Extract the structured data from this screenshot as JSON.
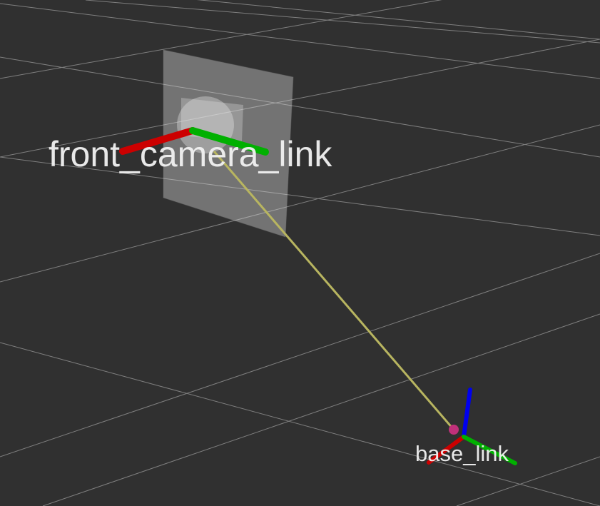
{
  "viewport": {
    "background_color": "#303030",
    "grid_color": "#9a9a9a"
  },
  "frames": {
    "front_camera": {
      "label": "front_camera_link"
    },
    "base": {
      "label": "base_link"
    }
  },
  "axis_colors": {
    "x": "#cc0000",
    "y": "#00b000",
    "z": "#0000ee"
  },
  "link_color": "#b8b560",
  "origin_marker_color": "#c0307a",
  "camera_body_color": "#d8d8d8"
}
